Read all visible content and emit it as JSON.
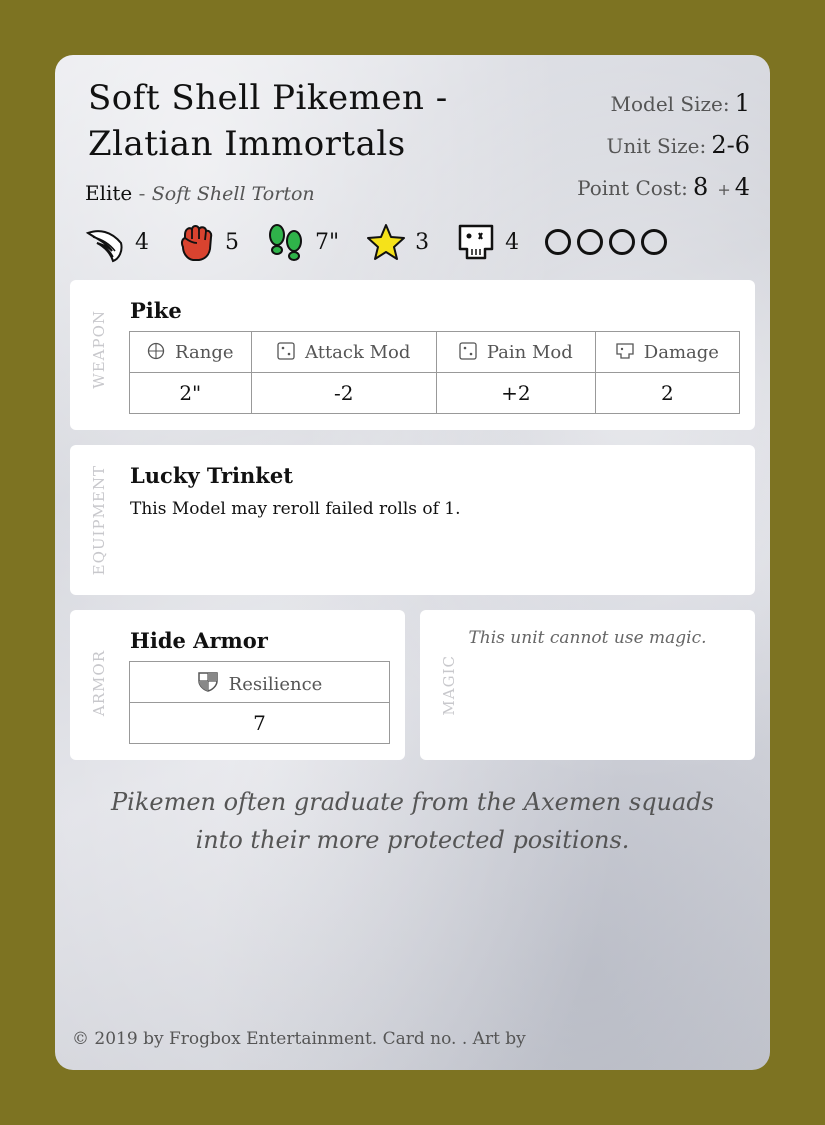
{
  "card": {
    "title": "Soft Shell Pikemen - Zlatian Immortals",
    "stats": {
      "model_size_label": "Model Size:",
      "model_size": "1",
      "unit_size_label": "Unit Size:",
      "unit_size": "2-6",
      "point_cost_label": "Point Cost:",
      "point_cost": "8",
      "point_plus": "+",
      "point_extra": "4"
    },
    "rank": "Elite",
    "rank_dash": "-",
    "race": "Soft Shell Torton",
    "attributes": [
      {
        "icon": "wing-icon",
        "value": "4"
      },
      {
        "icon": "fist-icon",
        "value": "5"
      },
      {
        "icon": "footprints-icon",
        "value": "7\""
      },
      {
        "icon": "star-icon",
        "value": "3"
      },
      {
        "icon": "skull-icon",
        "value": "4"
      }
    ],
    "wound_circles": 4,
    "weapon": {
      "side_label": "WEAPON",
      "name": "Pike",
      "headers": [
        "Range",
        "Attack Mod",
        "Pain Mod",
        "Damage"
      ],
      "values": [
        "2\"",
        "-2",
        "+2",
        "2"
      ]
    },
    "equipment": {
      "side_label": "EQUIPMENT",
      "name": "Lucky Trinket",
      "text": "This Model may reroll failed rolls of 1."
    },
    "armor": {
      "side_label": "ARMOR",
      "name": "Hide Armor",
      "header": "Resilience",
      "value": "7"
    },
    "magic": {
      "side_label": "MAGIC",
      "note": "This unit cannot use magic."
    },
    "flavor": "Pikemen often graduate from the Axemen squads into their more protected positions.",
    "footer": "© 2019 by Frogbox Entertainment. Card no. . Art by"
  },
  "colors": {
    "border": "#7d7322",
    "fist": "#d9432f",
    "footprints": "#2fb34a",
    "star": "#f5e21a"
  }
}
